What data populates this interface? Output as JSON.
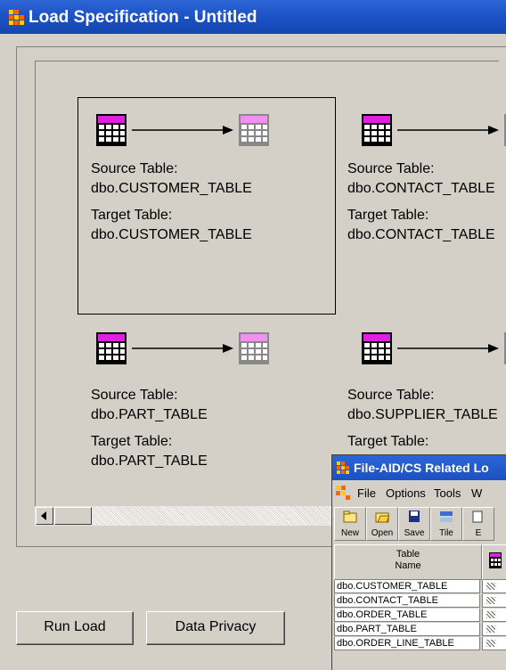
{
  "window": {
    "title": "Load Specification - Untitled"
  },
  "nodes": [
    {
      "source_label": "Source Table:",
      "source": "dbo.CUSTOMER_TABLE",
      "target_label": "Target Table:",
      "target": "dbo.CUSTOMER_TABLE",
      "selected": true
    },
    {
      "source_label": "Source Table:",
      "source": "dbo.CONTACT_TABLE",
      "target_label": "Target Table:",
      "target": "dbo.CONTACT_TABLE",
      "selected": false
    },
    {
      "source_label": "Source Table:",
      "source": "dbo.PART_TABLE",
      "target_label": "Target Table:",
      "target": "dbo.PART_TABLE",
      "selected": false
    },
    {
      "source_label": "Source Table:",
      "source": "dbo.SUPPLIER_TABLE",
      "target_label": "Target Table:",
      "target": "",
      "selected": false
    }
  ],
  "buttons": {
    "run_load": "Run Load",
    "data_privacy": "Data Privacy"
  },
  "related_window": {
    "title": "File-AID/CS Related Lo",
    "menu": [
      "File",
      "Options",
      "Tools",
      "W"
    ],
    "toolbar": [
      "New",
      "Open",
      "Save",
      "Tile",
      "E"
    ],
    "column_header": "Table\nName",
    "rows": [
      "dbo.CUSTOMER_TABLE",
      "dbo.CONTACT_TABLE",
      "dbo.ORDER_TABLE",
      "dbo.PART_TABLE",
      "dbo.ORDER_LINE_TABLE"
    ]
  },
  "colors": {
    "title_bar": "#1b50c2",
    "table_header": "#e020e0",
    "window_bg": "#d4d0c8"
  }
}
